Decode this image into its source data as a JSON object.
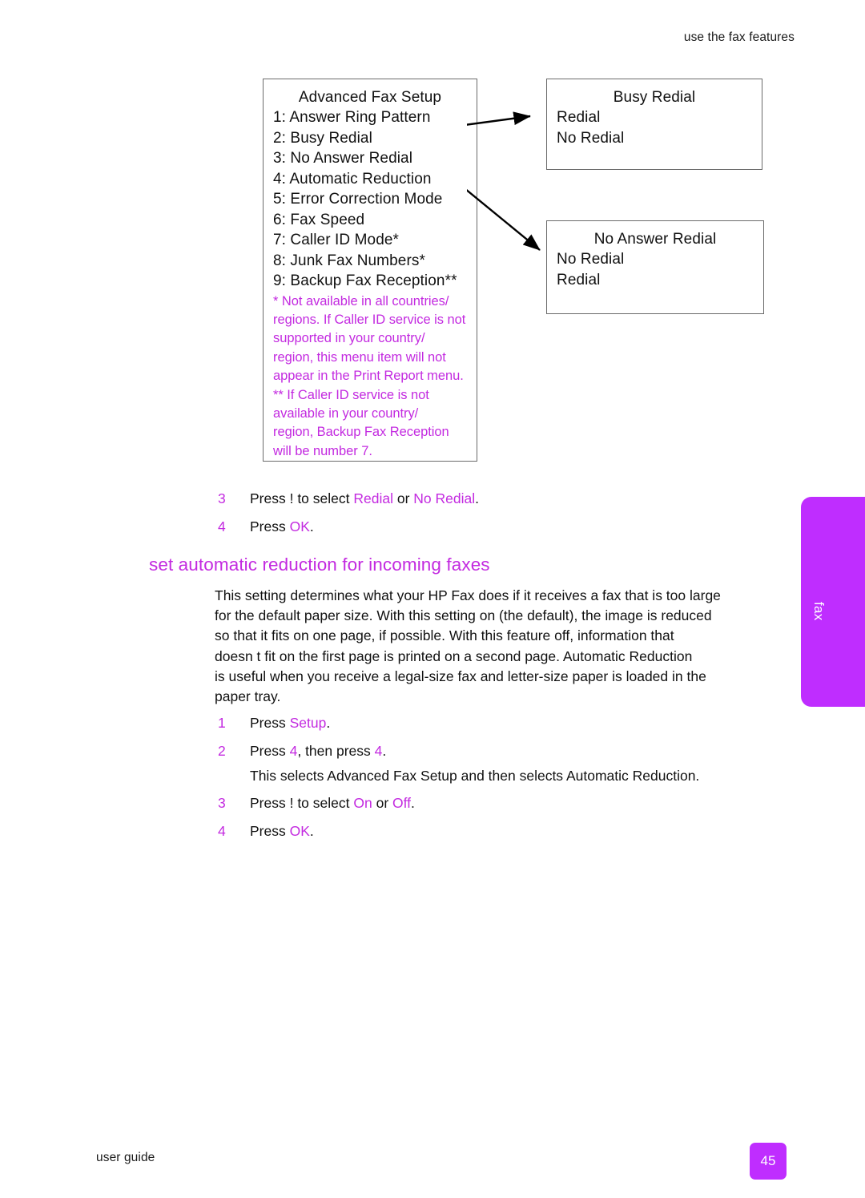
{
  "header": {
    "running_head": "use the fax features"
  },
  "edge_tab": {
    "label": "fax",
    "color": "#bf2dff"
  },
  "diagram": {
    "menu_box": {
      "title": "Advanced Fax Setup",
      "items": [
        "1: Answer Ring Pattern",
        "2: Busy Redial",
        "3: No Answer Redial",
        "4: Automatic Reduction",
        "5: Error Correction Mode",
        "6: Fax Speed",
        "7: Caller ID Mode*",
        "8: Junk Fax Numbers*",
        "9: Backup Fax Reception**"
      ],
      "footnotes": [
        "* Not available in all countries/",
        "regions. If Caller ID service is not",
        "supported in your country/",
        "region, this menu item will not",
        "appear in the Print Report menu.",
        "** If Caller ID service is not",
        "available in your country/",
        "region, Backup Fax Reception",
        "will be number 7."
      ],
      "footnote_color": "#c32ae0"
    },
    "busy_redial_box": {
      "title": "Busy Redial",
      "options": [
        "Redial",
        "No Redial"
      ]
    },
    "no_answer_redial_box": {
      "title": "No Answer Redial",
      "options": [
        "No Redial",
        "Redial"
      ]
    }
  },
  "steps_top": [
    {
      "num": "3",
      "parts": [
        {
          "text": "Press !   to select ",
          "kw": false
        },
        {
          "text": "Redial",
          "kw": true
        },
        {
          "text": " or ",
          "kw": false
        },
        {
          "text": "No Redial",
          "kw": true
        },
        {
          "text": ".",
          "kw": false
        }
      ]
    },
    {
      "num": "4",
      "parts": [
        {
          "text": "Press ",
          "kw": false
        },
        {
          "text": "OK",
          "kw": true
        },
        {
          "text": ".",
          "kw": false
        }
      ]
    }
  ],
  "section": {
    "heading": "set automatic reduction for incoming faxes",
    "paragraph_lines": [
      "This setting determines what your HP Fax does if it receives a fax that is too large",
      "for the default paper size. With this setting on (the default), the image is reduced",
      "so that it fits on one page, if possible. With this feature off, information that",
      "doesn t fit on the first page is printed on a second page. Automatic Reduction",
      "is useful when you receive a legal-size fax and letter-size paper is loaded in the",
      "paper tray."
    ]
  },
  "steps_bottom": [
    {
      "num": "1",
      "parts": [
        {
          "text": "Press ",
          "kw": false
        },
        {
          "text": "Setup",
          "kw": true
        },
        {
          "text": ".",
          "kw": false
        }
      ]
    },
    {
      "num": "2",
      "parts": [
        {
          "text": "Press ",
          "kw": false
        },
        {
          "text": "4",
          "kw": true
        },
        {
          "text": ", then press ",
          "kw": false
        },
        {
          "text": "4",
          "kw": true
        },
        {
          "text": ".",
          "kw": false
        }
      ]
    },
    {
      "num": "3",
      "parts": [
        {
          "text": "Press !   to select ",
          "kw": false
        },
        {
          "text": "On",
          "kw": true
        },
        {
          "text": " or ",
          "kw": false
        },
        {
          "text": "Off",
          "kw": true
        },
        {
          "text": ".",
          "kw": false
        }
      ]
    },
    {
      "num": "4",
      "parts": [
        {
          "text": "Press ",
          "kw": false
        },
        {
          "text": "OK",
          "kw": true
        },
        {
          "text": ".",
          "kw": false
        }
      ]
    }
  ],
  "step2_note": "This selects Advanced Fax Setup and then selects Automatic Reduction.",
  "footer": {
    "left_text": "user guide",
    "page_number": "45"
  }
}
